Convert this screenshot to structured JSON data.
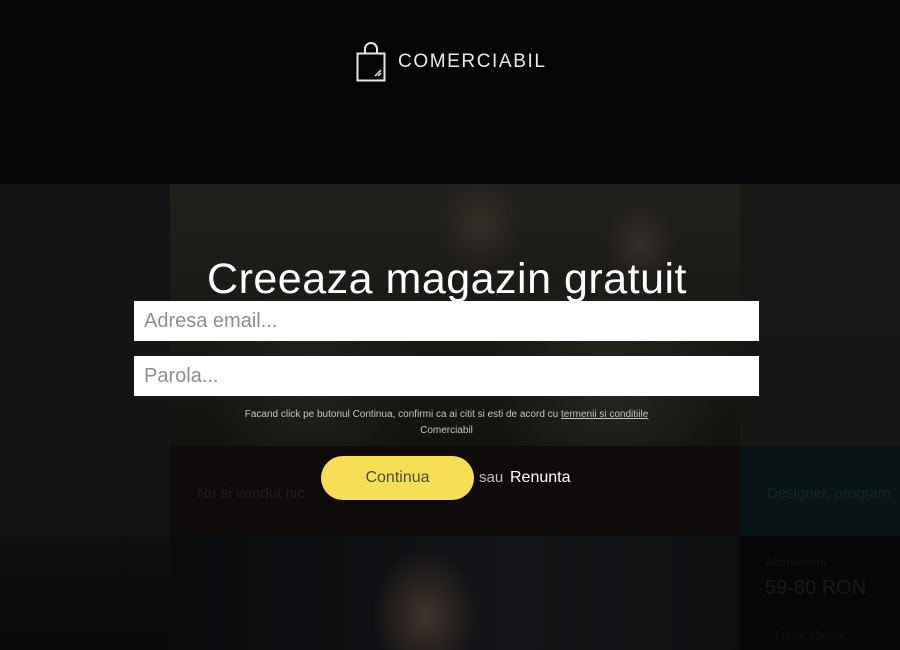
{
  "brand": {
    "name": "COMERCIABIL",
    "icon": "shopping-bag-icon"
  },
  "form": {
    "headline": "Creeaza magazin gratuit",
    "email_placeholder": "Adresa email...",
    "password_placeholder": "Parola...",
    "terms_text": "Facand click pe butonul Continua, confirmi ca ai citit si esti de acord cu ",
    "terms_link": "termenii si conditiile",
    "terms_suffix": "Comerciabil",
    "continue_label": "Continua",
    "or_text": "sau",
    "cancel_label": "Renunta"
  },
  "background": {
    "card_text_1": "Nu ai vandut nic",
    "card_text_2": "Designer, program",
    "card_small_1": "Abonament",
    "card_price": "59-80 RON",
    "card_small_2": "Lunar abonat"
  },
  "colors": {
    "accent": "#f6df55",
    "overlay": "#000000",
    "field_bg": "#ffffff"
  }
}
